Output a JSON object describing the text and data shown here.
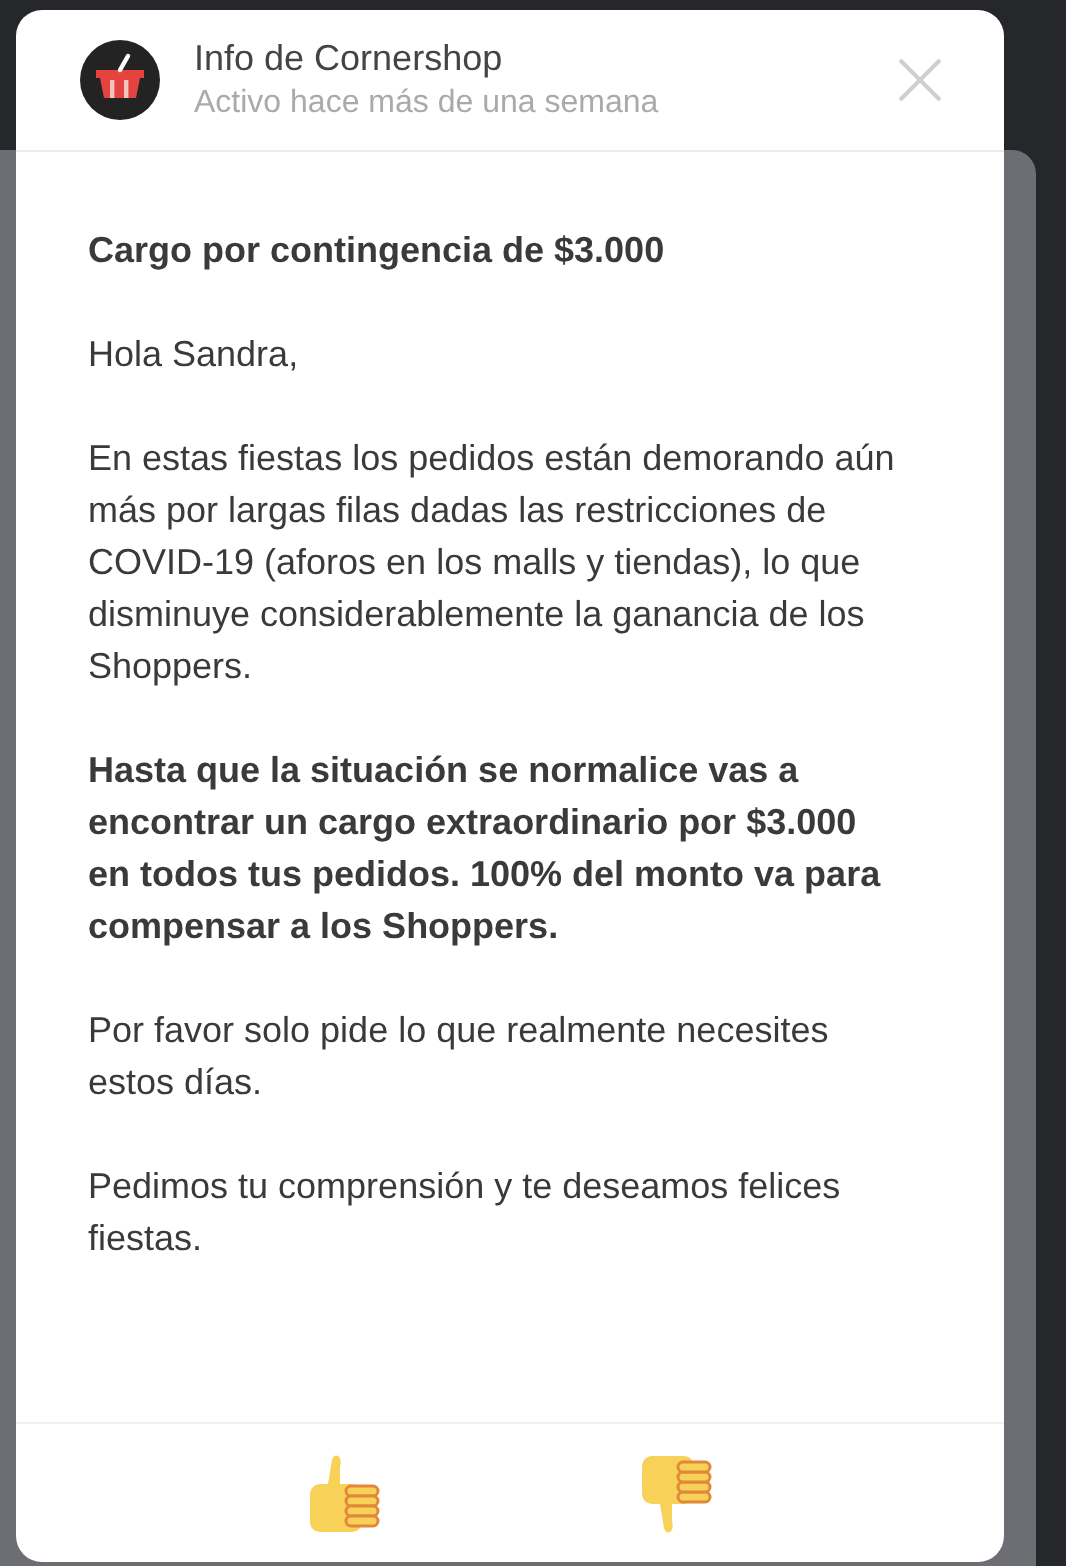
{
  "modal": {
    "title": "Info de Cornershop",
    "subtitle": "Activo hace más de una semana",
    "heading": "Cargo por contingencia de $3.000",
    "paragraphs": [
      {
        "text": "Hola Sandra,",
        "bold": false
      },
      {
        "text": "En estas fiestas los pedidos están demorando aún más por largas filas dadas las restricciones de COVID-19 (aforos en los malls y tiendas), lo que disminuye considerablemente la ganancia de los Shoppers.",
        "bold": false
      },
      {
        "text": "Hasta que la situación se normalice vas a encontrar un cargo extraordinario por $3.000 en todos tus pedidos. 100% del monto va para compensar a los Shoppers.",
        "bold": true
      },
      {
        "text": "Por favor solo pide lo que realmente necesites estos días.",
        "bold": false
      },
      {
        "text": "Pedimos tu comprensión y te deseamos felices fiestas.",
        "bold": false
      }
    ],
    "reactions": [
      {
        "kind": "up"
      },
      {
        "kind": "down"
      }
    ]
  }
}
